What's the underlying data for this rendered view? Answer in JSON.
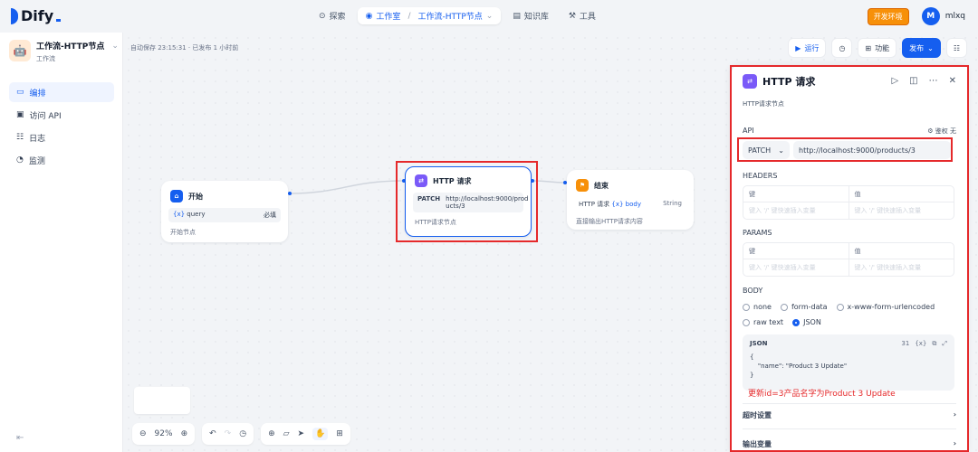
{
  "brand": {
    "name": "Dify",
    "accent": "#155eef"
  },
  "nav": {
    "explore": "探索",
    "studio": "工作室",
    "crumb": "工作流-HTTP节点",
    "knowledge": "知识库",
    "tools": "工具"
  },
  "env_badge": "开发环境",
  "user": {
    "initial": "M",
    "name": "mlxq"
  },
  "app": {
    "name": "工作流-HTTP节点",
    "type": "工作流"
  },
  "sidebar": {
    "items": [
      {
        "label": "编排",
        "icon": "layout-icon"
      },
      {
        "label": "访问 API",
        "icon": "terminal-icon"
      },
      {
        "label": "日志",
        "icon": "log-icon"
      },
      {
        "label": "监测",
        "icon": "monitor-icon"
      }
    ]
  },
  "toolbar": {
    "autosave": "自动保存 23:15:31 · 已发布 1 小时前",
    "run": "运行",
    "features": "功能",
    "publish": "发布"
  },
  "nodes": {
    "start": {
      "title": "开始",
      "var_name": "query",
      "var_meta": "必填",
      "desc": "开始节点"
    },
    "http": {
      "title": "HTTP 请求",
      "method": "PATCH",
      "url_line1": "http://localhost:9000/prod",
      "url_line2": "ucts/3",
      "desc": "HTTP请求节点"
    },
    "end": {
      "title": "结束",
      "var_name": "HTTP 请求",
      "var_field": "body",
      "var_type": "String",
      "desc": "直接输出HTTP请求内容"
    }
  },
  "zoom": "92%",
  "panel": {
    "title": "HTTP 请求",
    "desc": "HTTP请求节点",
    "api_label": "API",
    "auth": "鉴权 无",
    "method": "PATCH",
    "url": "http://localhost:9000/products/3",
    "headers_label": "HEADERS",
    "params_label": "PARAMS",
    "key_header": "键",
    "value_header": "值",
    "key_placeholder": "键入 '/' 键快速插入变量",
    "value_placeholder": "键入 '/' 键快速插入变量",
    "body_label": "BODY",
    "body_types": [
      "none",
      "form-data",
      "x-www-form-urlencoded",
      "raw text",
      "JSON"
    ],
    "body_selected": "JSON",
    "json_label": "JSON",
    "json_count": "31",
    "json_lines": [
      "{",
      "    \"name\": \"Product 3 Update\"",
      "}"
    ],
    "annotation": "更新id=3产品名字为Product 3 Update",
    "timeout_label": "超时设置",
    "output_label": "输出变量"
  }
}
